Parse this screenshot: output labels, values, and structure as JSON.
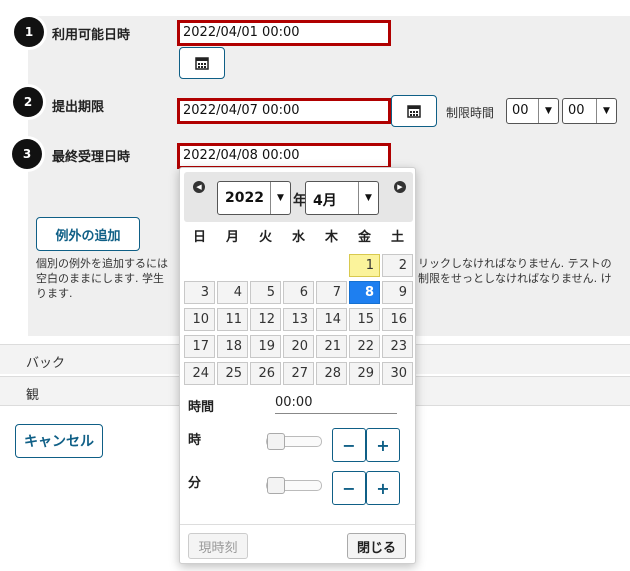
{
  "steps": [
    {
      "num": "1",
      "label": "利用可能日時",
      "value": "2022/04/01 00:00"
    },
    {
      "num": "2",
      "label": "提出期限",
      "value": "2022/04/07 00:00"
    },
    {
      "num": "3",
      "label": "最終受理日時",
      "value": "2022/04/08 00:00"
    }
  ],
  "limit_time": {
    "label": "制限時間",
    "hour": "00",
    "minute": "00"
  },
  "add_exception_label": "例外の追加",
  "description_lines": [
    "個別の例外を追加するには",
    "空白のままにします. 学生",
    "ります."
  ],
  "description_right_lines": [
    "リックしなければなりません. テストの",
    "制限をせっとしなければなりません. け",
    ""
  ],
  "bands": [
    "バック",
    "観"
  ],
  "cancel_label": "キャンセル",
  "calendar": {
    "year": "2022",
    "year_suffix": "年",
    "month": "4月",
    "weekdays": [
      "日",
      "月",
      "火",
      "水",
      "木",
      "金",
      "土"
    ],
    "weeks": [
      [
        "",
        "",
        "",
        "",
        "",
        "1",
        "2"
      ],
      [
        "3",
        "4",
        "5",
        "6",
        "7",
        "8",
        "9"
      ],
      [
        "10",
        "11",
        "12",
        "13",
        "14",
        "15",
        "16"
      ],
      [
        "17",
        "18",
        "19",
        "20",
        "21",
        "22",
        "23"
      ],
      [
        "24",
        "25",
        "26",
        "27",
        "28",
        "29",
        "30"
      ]
    ],
    "today": "1",
    "selected": "8",
    "time_label": "時間",
    "time_value": "00:00",
    "hour_label": "時",
    "minute_label": "分",
    "now_label": "現時刻",
    "close_label": "閉じる"
  },
  "colors": {
    "accent": "#0f5f86",
    "highlight_border": "#b00000",
    "selected_day": "#1e7ff0",
    "today_day": "#fbf39b"
  }
}
